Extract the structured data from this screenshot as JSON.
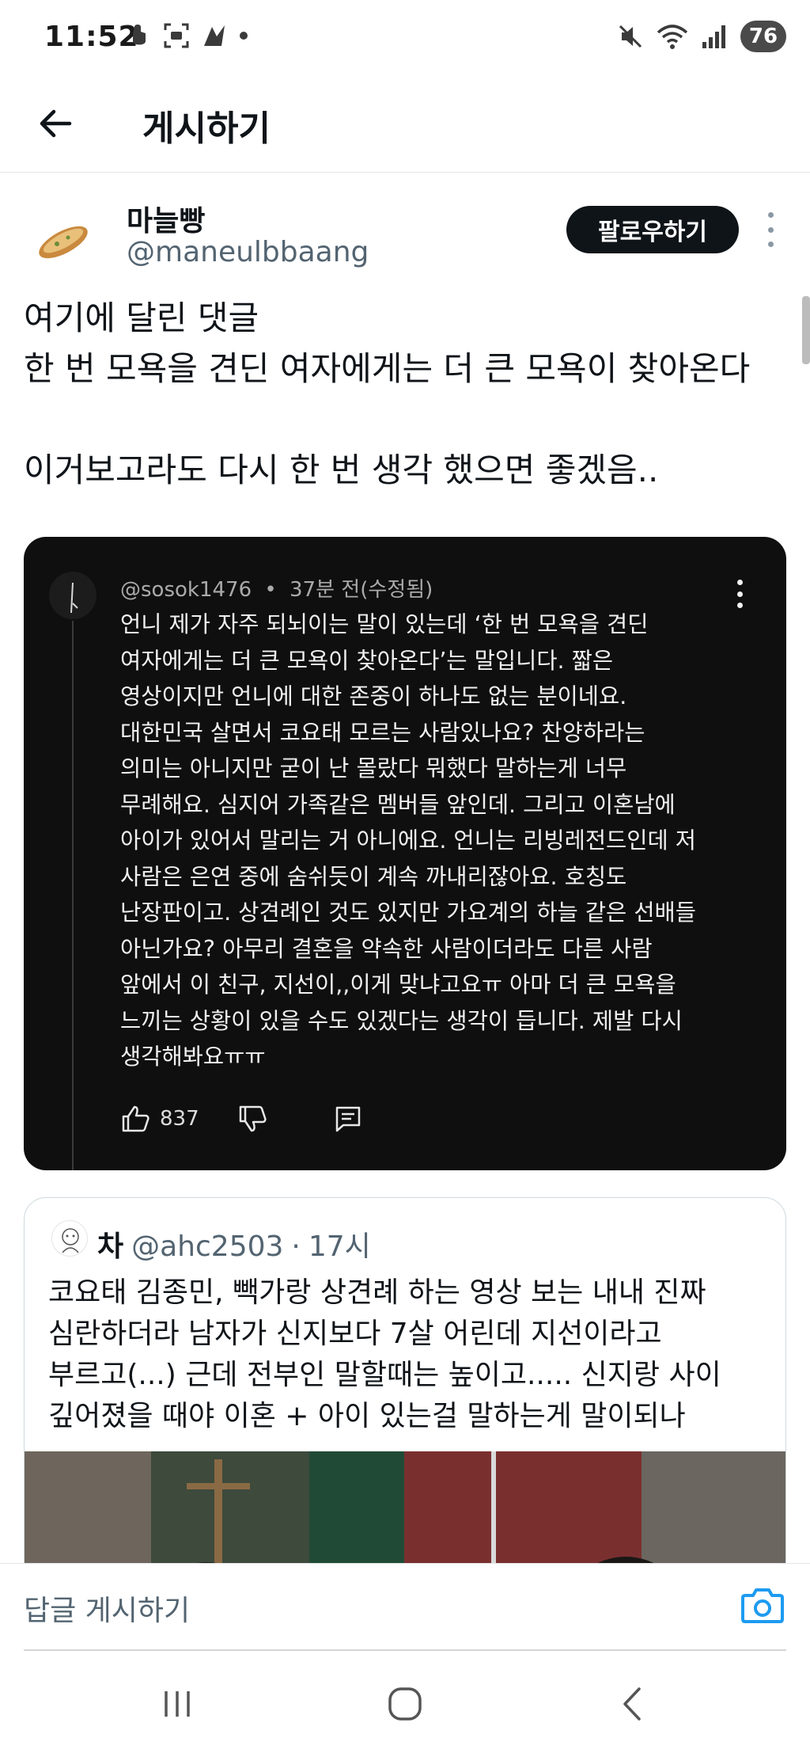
{
  "status_bar": {
    "time": "11:52",
    "battery": "76",
    "left_icons": [
      "notification-icon",
      "screenshot-icon",
      "app-icon",
      "dot-icon"
    ],
    "right_icons": [
      "mute-icon",
      "wifi-icon",
      "signal-icon"
    ]
  },
  "header": {
    "title": "게시하기"
  },
  "author": {
    "name": "마늘빵",
    "handle": "@maneulbbaang",
    "follow_label": "팔로우하기"
  },
  "post": {
    "text": "여기에 달린 댓글\n한 번 모욕을 견딘 여자에게는 더 큰 모욕이 찾아온다\n\n이거보고라도 다시 한 번 생각 했으면 좋겠음.."
  },
  "embedded_comment": {
    "handle": "@sosok1476",
    "separator": "•",
    "time": "37분 전(수정됨)",
    "lines": [
      "언니 제가 자주 되뇌이는 말이 있는데 ‘한 번 모욕을 견딘",
      "여자에게는 더 큰 모욕이 찾아온다’는 말입니다. 짧은",
      "영상이지만 언니에 대한 존중이 하나도 없는 분이네요.",
      "대한민국 살면서 코요태 모르는 사람있나요? 찬양하라는",
      "의미는 아니지만 굳이 난 몰랐다 뭐했다 말하는게 너무",
      "무례해요. 심지어 가족같은 멤버들 앞인데. 그리고 이혼남에",
      "아이가 있어서 말리는 거 아니에요. 언니는 리빙레전드인데 저",
      "사람은 은연 중에 숨쉬듯이 계속 까내리잖아요. 호칭도",
      "난장판이고. 상견례인 것도 있지만 가요계의 하늘 같은 선배들",
      "아닌가요? 아무리 결혼을 약속한 사람이더라도 다른 사람",
      "앞에서 이 친구, 지선이,,이게 맞냐고요ㅠ 아마 더 큰 모욕을",
      "느끼는 상황이 있을 수도 있겠다는 생각이 듭니다. 제발 다시",
      "생각해봐요ㅠㅠ"
    ],
    "like_count": "837"
  },
  "quote": {
    "name": "차",
    "handle": "@ahc2503",
    "separator": "·",
    "time": "17시",
    "lines": [
      "코요태 김종민, 빽가랑 상견례 하는 영상 보는 내내 진짜",
      "심란하더라 남자가 신지보다 7살 어린데 지선이라고",
      "부르고(...) 근데 전부인 말할때는 높이고..... 신지랑 사이",
      "깊어졌을 때야 이혼 + 아이 있는걸 말하는게 말이되나"
    ]
  },
  "reply_bar": {
    "placeholder": "답글 게시하기"
  },
  "colors": {
    "text": "#0f1419",
    "secondary": "#536471",
    "accent_blue": "#1d9bf0",
    "dark_card": "#0f0f0f"
  }
}
